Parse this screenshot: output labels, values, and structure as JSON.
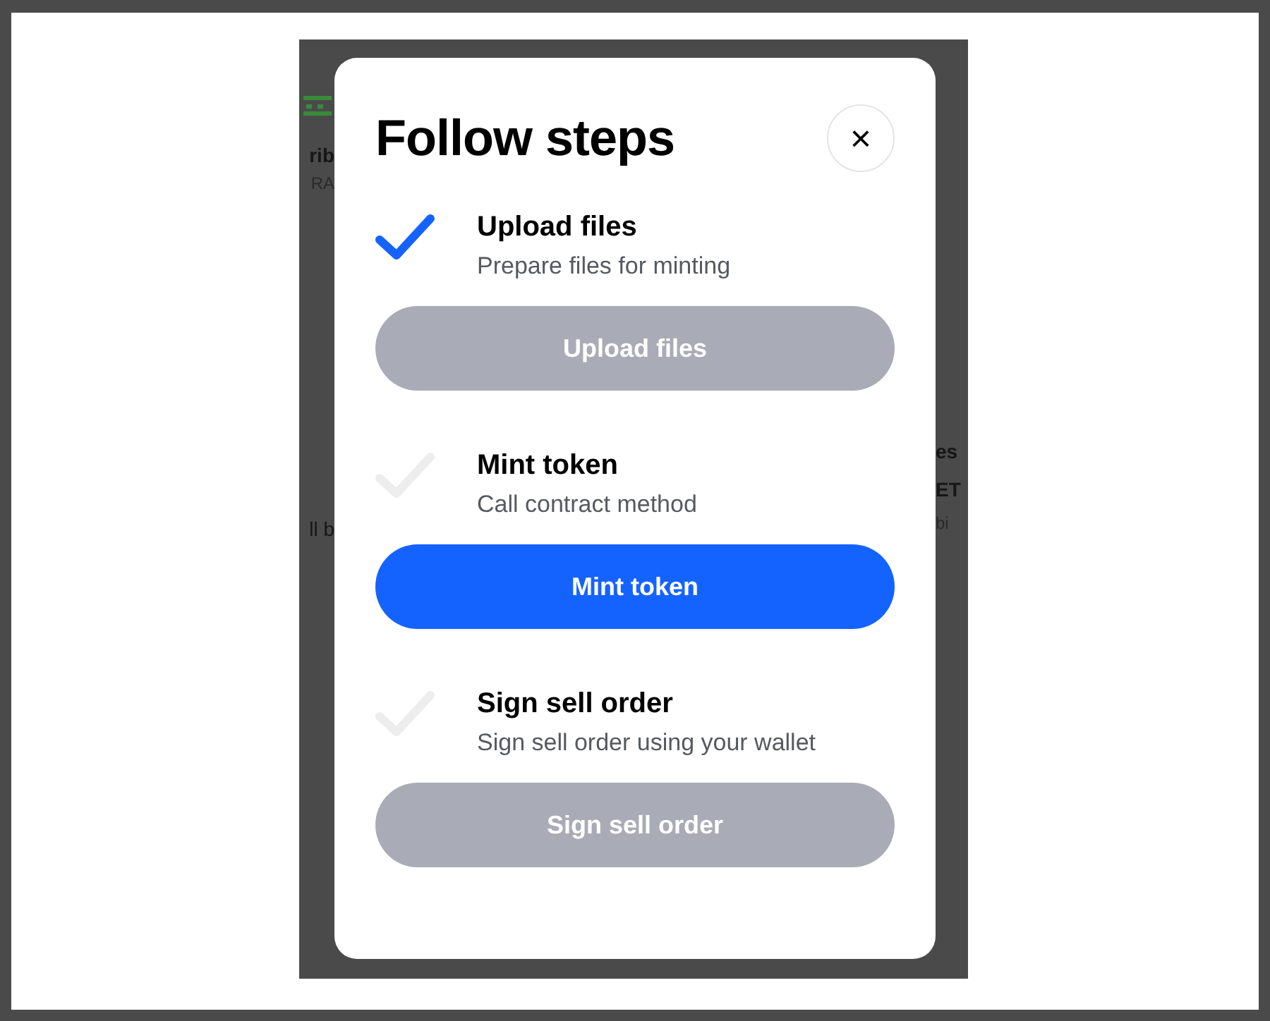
{
  "background": {
    "left_texts": [
      "rib",
      "RA",
      "ll b"
    ],
    "right_texts": [
      "es",
      "ET",
      "bi"
    ]
  },
  "dialog": {
    "title": "Follow steps",
    "close_label": "×",
    "steps": [
      {
        "title": "Upload files",
        "subtitle": "Prepare files for minting",
        "button": "Upload files",
        "done": true,
        "disabled": true
      },
      {
        "title": "Mint token",
        "subtitle": "Call contract method",
        "button": "Mint token",
        "done": false,
        "disabled": false
      },
      {
        "title": "Sign sell order",
        "subtitle": "Sign sell order using your wallet",
        "button": "Sign sell order",
        "done": false,
        "disabled": true
      }
    ]
  }
}
